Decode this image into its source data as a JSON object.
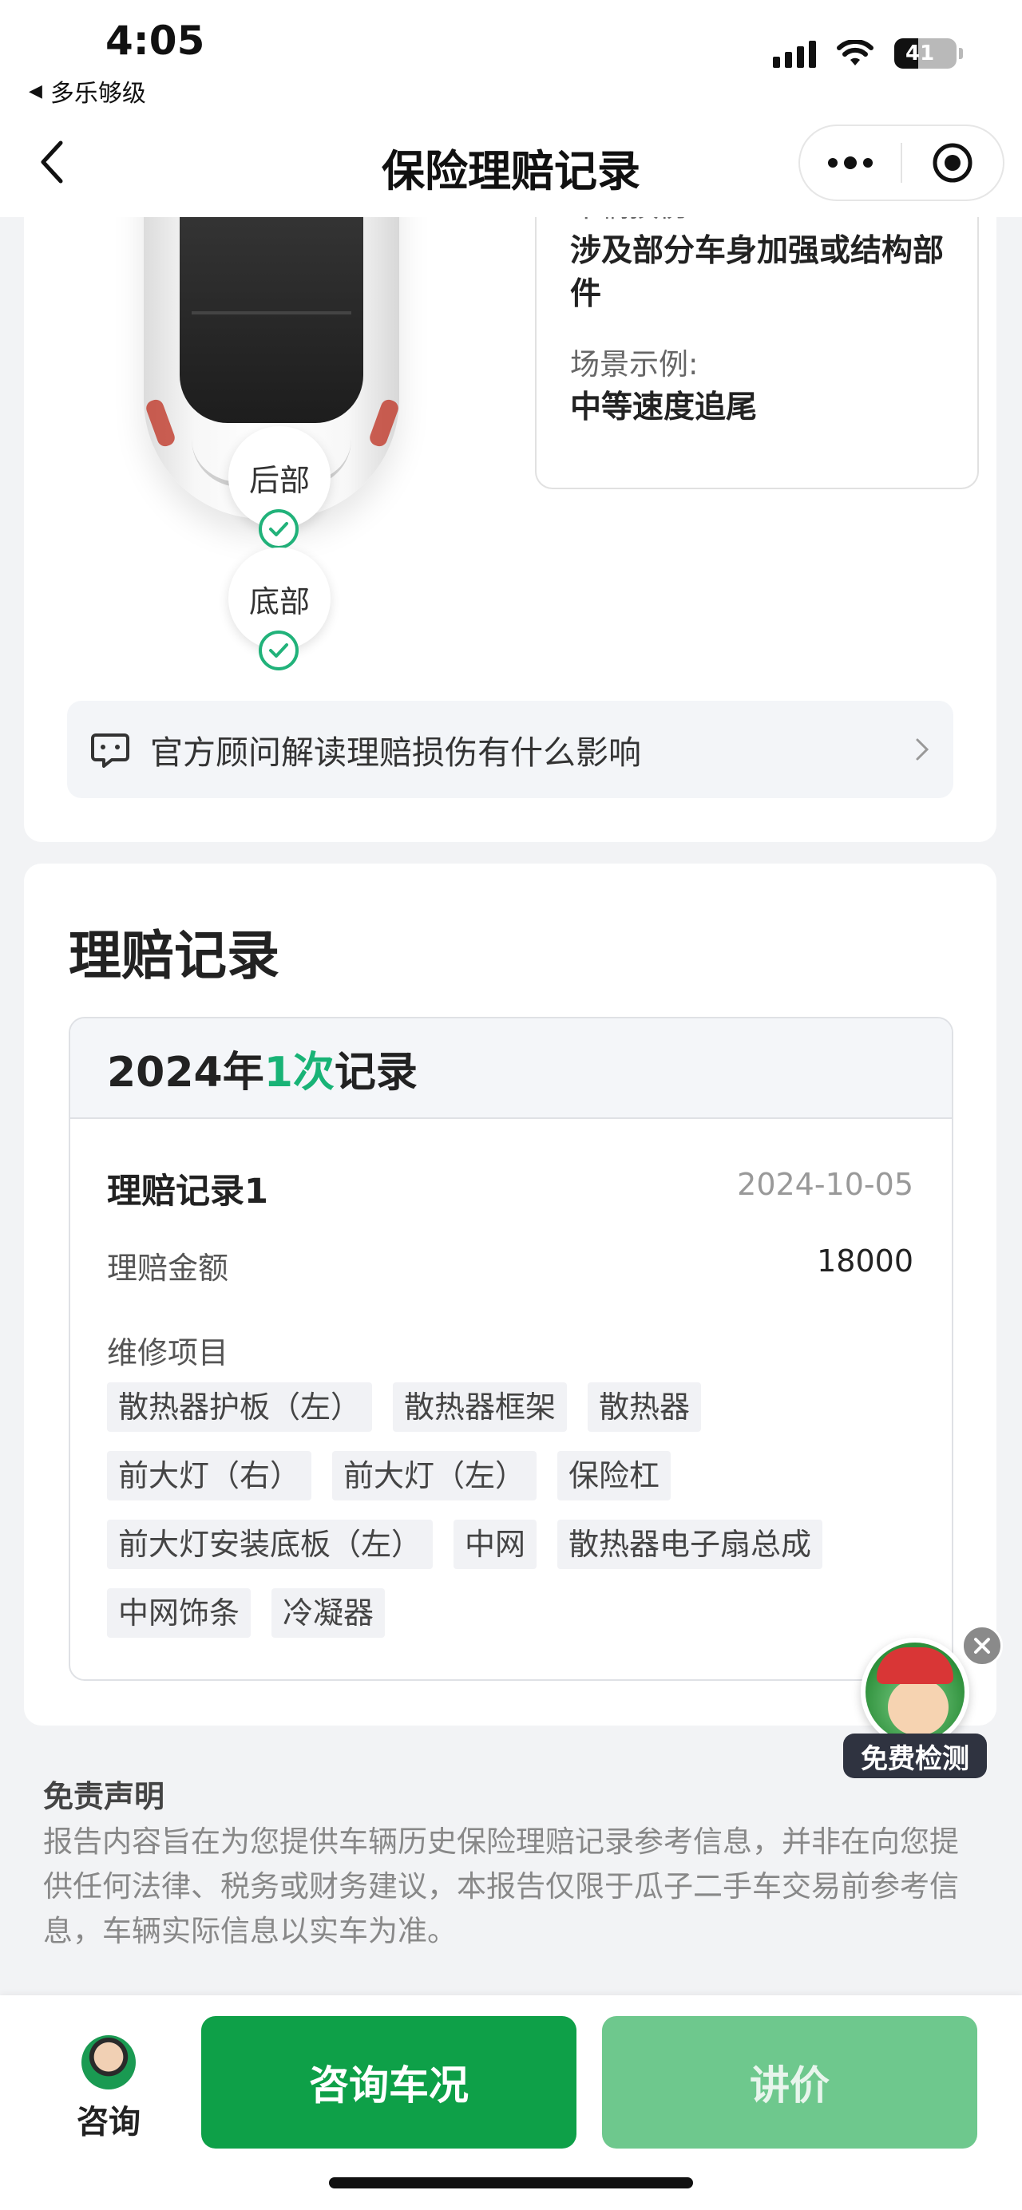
{
  "status_bar": {
    "time": "4:05",
    "back_app": "多乐够级",
    "battery": "41"
  },
  "nav": {
    "title": "保险理赔记录"
  },
  "car": {
    "labels": {
      "rear": "后部",
      "bottom": "底部"
    }
  },
  "damage": {
    "damage_label": "车辆损伤:",
    "damage_value": "涉及部分车身加强或结构部件",
    "scene_label": "场景示例:",
    "scene_value": "中等速度追尾"
  },
  "advisor": {
    "text": "官方顾问解读理赔损伤有什么影响"
  },
  "claims": {
    "section_title": "理赔记录",
    "year_prefix": "2024年",
    "count": "1次",
    "year_suffix": "记录",
    "record": {
      "name": "理赔记录1",
      "date": "2024-10-05",
      "amount_label": "理赔金额",
      "amount_value": "18000",
      "items_label": "维修项目",
      "items": [
        "散热器护板（左）",
        "散热器框架",
        "散热器",
        "前大灯（右）",
        "前大灯（左）",
        "保险杠",
        "前大灯安装底板（左）",
        "中网",
        "散热器电子扇总成",
        "中网饰条",
        "冷凝器"
      ]
    }
  },
  "disclaimer": {
    "title": "免责声明",
    "text": "报告内容旨在为您提供车辆历史保险理赔记录参考信息，并非在向您提供任何法律、税务或财务建议，本报告仅限于瓜子二手车交易前参考信息，车辆实际信息以实车为准。"
  },
  "float_badge": {
    "label": "免费检测"
  },
  "bottom": {
    "consult": "咨询",
    "primary": "咨询车况",
    "secondary": "讲价"
  },
  "colors": {
    "accent_green": "#18b376",
    "button_green": "#0ea048",
    "button_disabled": "#6ec88d"
  },
  "icons": [
    "signal-icon",
    "wifi-icon",
    "battery-icon",
    "back-chevron-icon",
    "more-icon",
    "record-icon",
    "check-icon",
    "chat-icon",
    "chevron-right-icon",
    "close-icon"
  ]
}
